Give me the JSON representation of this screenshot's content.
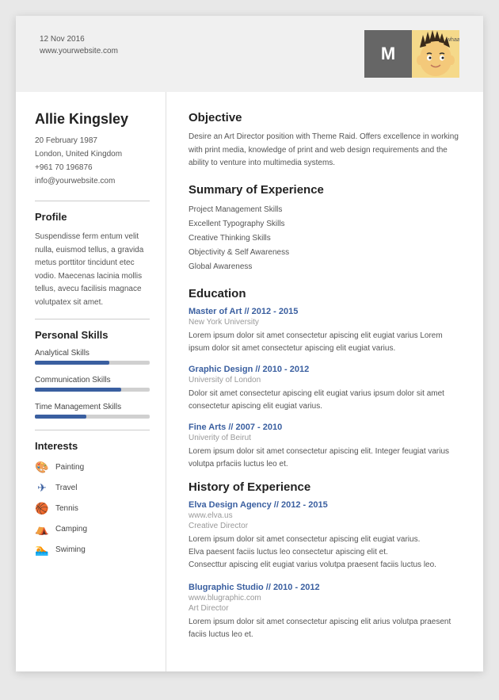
{
  "header": {
    "date": "12 Nov 2016",
    "website": "www.yourwebsite.com",
    "avatar_initial": "M"
  },
  "left": {
    "name": "Allie Kingsley",
    "contact": {
      "birthday": "20 February 1987",
      "location": "London, United Kingdom",
      "phone": "+961 70 196876",
      "email": "info@yourwebsite.com"
    },
    "profile_title": "Profile",
    "profile_text": "Suspendisse ferm entum velit nulla, euismod tellus, a gravida metus porttitor tincidunt etec vodio. Maecenas lacinia mollis tellus, avecu facilisis magnace volutpatex sit amet.",
    "skills_title": "Personal Skills",
    "skills": [
      {
        "label": "Analytical Skills",
        "percent": 65
      },
      {
        "label": "Communication Skills",
        "percent": 75
      },
      {
        "label": "Time Management Skills",
        "percent": 45
      }
    ],
    "interests_title": "Interests",
    "interests": [
      {
        "icon": "🎨",
        "label": "Painting"
      },
      {
        "icon": "✈",
        "label": "Travel"
      },
      {
        "icon": "🏀",
        "label": "Tennis"
      },
      {
        "icon": "⛺",
        "label": "Camping"
      },
      {
        "icon": "🏊",
        "label": "Swiming"
      }
    ]
  },
  "right": {
    "objective_title": "Objective",
    "objective_text": "Desire an Art Director position with Theme Raid. Offers excellence in working with print media, knowledge of print and web design requirements and the ability to venture into multimedia systems.",
    "summary_title": "Summary of Experience",
    "summary_items": [
      "Project Management Skills",
      "Excellent Typography Skills",
      "Creative Thinking Skills",
      "Objectivity & Self Awareness",
      "Global Awareness"
    ],
    "education_title": "Education",
    "education": [
      {
        "title": "Master of Art // 2012 - 2015",
        "school": "New York University",
        "desc": "Lorem ipsum dolor sit amet consectetur apiscing elit eugiat varius Lorem ipsum dolor sit amet consectetur apiscing elit eugiat varius."
      },
      {
        "title": "Graphic Design // 2010 - 2012",
        "school": "University of London",
        "desc": "Dolor sit amet consectetur apiscing elit eugiat varius  ipsum dolor sit amet consectetur apiscing elit eugiat varius."
      },
      {
        "title": "Fine Arts // 2007 - 2010",
        "school": "Univerity of Beirut",
        "desc": "Lorem ipsum dolor sit amet consectetur apiscing elit. Integer feugiat varius volutpa prfaciis luctus leo et."
      }
    ],
    "history_title": "History of Experience",
    "history": [
      {
        "title": "Elva Design Agency // 2012 - 2015",
        "website": "www.elva.us",
        "role": "Creative Director",
        "desc": "Lorem ipsum dolor sit amet consectetur apiscing elit eugiat varius.\nElva paesent faciis luctus leo consectetur apiscing elit et.\nConsecttur apiscing elit eugiat varius volutpa praesent faciis luctus leo."
      },
      {
        "title": "Blugraphic Studio // 2010 - 2012",
        "website": "www.blugraphic.com",
        "role": "Art Director",
        "desc": "Lorem ipsum dolor sit amet consectetur apiscing elit arius volutpa praesent faciis luctus leo et."
      }
    ]
  }
}
